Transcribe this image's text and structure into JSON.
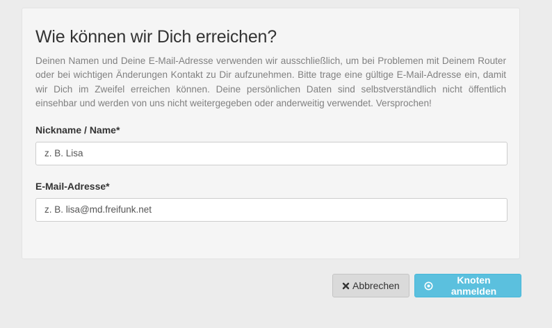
{
  "form": {
    "title": "Wie können wir Dich erreichen?",
    "intro": "Deinen Namen und Deine E-Mail-Adresse verwenden wir ausschließlich, um bei Problemen mit Deinem Router oder bei wichtigen Änderungen Kontakt zu Dir aufzunehmen. Bitte trage eine gültige E-Mail-Adresse ein, damit wir Dich im Zweifel erreichen können. Deine persönlichen Daten sind selbstverständlich nicht öffentlich einsehbar und werden von uns nicht weitergegeben oder anderweitig verwendet. Versprochen!",
    "name_field": {
      "label": "Nickname / Name*",
      "value": "",
      "placeholder": "z. B. Lisa"
    },
    "email_field": {
      "label": "E-Mail-Adresse*",
      "value": "",
      "placeholder": "z. B. lisa@md.freifunk.net"
    }
  },
  "actions": {
    "cancel_label": "Abbrechen",
    "cancel_icon": "close-icon",
    "submit_label": "Knoten anmelden",
    "submit_icon": "circle-dot-icon"
  },
  "colors": {
    "background": "#ececec",
    "panel": "#f5f5f5",
    "primary": "#5bc0de",
    "cancel": "#dadada"
  }
}
